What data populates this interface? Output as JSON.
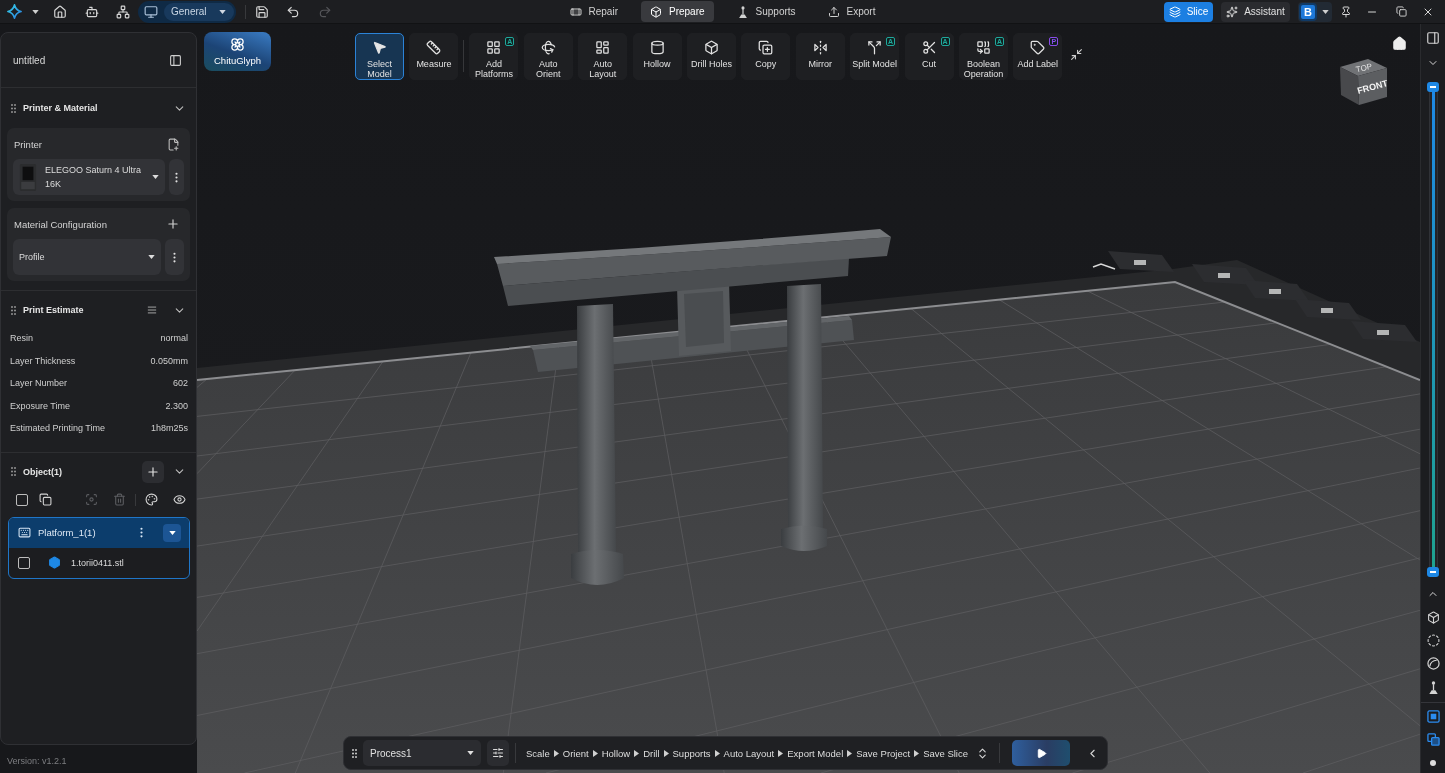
{
  "title_bar": {
    "workspace": "General",
    "undo": {
      "disabled": false
    },
    "redo": {
      "disabled": true
    },
    "modes": [
      {
        "label": "Repair",
        "selected": false
      },
      {
        "label": "Prepare",
        "selected": true
      },
      {
        "label": "Supports",
        "selected": false
      },
      {
        "label": "Export",
        "selected": false
      }
    ],
    "slice_button": "Slice",
    "assistant_button": "Assistant",
    "account_logo": "B"
  },
  "sidebar": {
    "project_name": "untitled",
    "printer_material": {
      "title": "Printer & Material",
      "expanded": true,
      "printer_label": "Printer",
      "printer": "ELEGOO Saturn 4 Ultra 16K",
      "material_label": "Material Configuration",
      "material_profile": "Profile"
    },
    "print_estimate": {
      "title": "Print Estimate",
      "expanded": true,
      "rows": [
        {
          "label": "Resin",
          "value": "normal"
        },
        {
          "label": "Layer Thickness",
          "value": "0.050mm"
        },
        {
          "label": "Layer Number",
          "value": "602"
        },
        {
          "label": "Exposure Time",
          "value": "2.300"
        },
        {
          "label": "Estimated Printing Time",
          "value": "1h8m25s"
        }
      ]
    },
    "objects": {
      "title": "Object(1)",
      "expanded": true,
      "select_all": {
        "checked": false
      },
      "tools": [
        {
          "disabled": false
        },
        {
          "disabled": true
        },
        {
          "disabled": true
        },
        {
          "disabled": false
        },
        {
          "disabled": false
        }
      ],
      "platforms": [
        {
          "name": "Platform_1(1)",
          "selected": true,
          "expanded": true,
          "children": [
            {
              "name": "1.torii0411.stl",
              "checked": false
            }
          ]
        }
      ]
    }
  },
  "version": "Version: v1.2.1",
  "toolbar": {
    "glyph_button": "ChituGlyph",
    "groups": [
      [
        {
          "label": "Select Model",
          "selected": true
        },
        {
          "label": "Measure",
          "selected": false
        }
      ],
      [
        {
          "label": "Add Platforms",
          "selected": false,
          "badge": {
            "text": "A",
            "color": "#1fa89c"
          }
        },
        {
          "label": "Auto Orient",
          "selected": false
        },
        {
          "label": "Auto Layout",
          "selected": false
        },
        {
          "label": "Hollow",
          "selected": false
        },
        {
          "label": "Drill Holes",
          "selected": false
        },
        {
          "label": "Copy",
          "selected": false
        },
        {
          "label": "Mirror",
          "selected": false
        },
        {
          "label": "Split Model",
          "selected": false,
          "badge": {
            "text": "A",
            "color": "#1fa89c"
          }
        },
        {
          "label": "Cut",
          "selected": false,
          "badge": {
            "text": "A",
            "color": "#1fa89c"
          }
        },
        {
          "label": "Boolean Operation",
          "selected": false,
          "badge": {
            "text": "A",
            "color": "#1fa89c"
          }
        },
        {
          "label": "Add Label",
          "selected": false,
          "badge": {
            "text": "P",
            "color": "#8a4be8"
          }
        }
      ]
    ]
  },
  "view_cube": {
    "front": "FRONT",
    "top": "TOP"
  },
  "process_bar": {
    "process": "Process1",
    "steps": [
      "Scale",
      "Orient",
      "Hollow",
      "Drill",
      "Supports",
      "Auto Layout",
      "Export Model",
      "Save Project",
      "Save Slice"
    ]
  },
  "layer_slider": {
    "level": 1
  }
}
